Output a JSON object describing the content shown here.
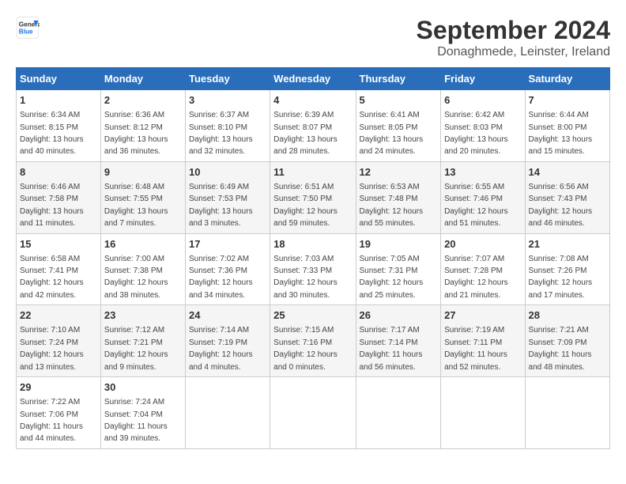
{
  "header": {
    "logo_general": "General",
    "logo_blue": "Blue",
    "main_title": "September 2024",
    "subtitle": "Donaghmede, Leinster, Ireland"
  },
  "days_of_week": [
    "Sunday",
    "Monday",
    "Tuesday",
    "Wednesday",
    "Thursday",
    "Friday",
    "Saturday"
  ],
  "weeks": [
    [
      {
        "day": "1",
        "sunrise": "6:34 AM",
        "sunset": "8:15 PM",
        "daylight": "13 hours and 40 minutes."
      },
      {
        "day": "2",
        "sunrise": "6:36 AM",
        "sunset": "8:12 PM",
        "daylight": "13 hours and 36 minutes."
      },
      {
        "day": "3",
        "sunrise": "6:37 AM",
        "sunset": "8:10 PM",
        "daylight": "13 hours and 32 minutes."
      },
      {
        "day": "4",
        "sunrise": "6:39 AM",
        "sunset": "8:07 PM",
        "daylight": "13 hours and 28 minutes."
      },
      {
        "day": "5",
        "sunrise": "6:41 AM",
        "sunset": "8:05 PM",
        "daylight": "13 hours and 24 minutes."
      },
      {
        "day": "6",
        "sunrise": "6:42 AM",
        "sunset": "8:03 PM",
        "daylight": "13 hours and 20 minutes."
      },
      {
        "day": "7",
        "sunrise": "6:44 AM",
        "sunset": "8:00 PM",
        "daylight": "13 hours and 15 minutes."
      }
    ],
    [
      {
        "day": "8",
        "sunrise": "6:46 AM",
        "sunset": "7:58 PM",
        "daylight": "13 hours and 11 minutes."
      },
      {
        "day": "9",
        "sunrise": "6:48 AM",
        "sunset": "7:55 PM",
        "daylight": "13 hours and 7 minutes."
      },
      {
        "day": "10",
        "sunrise": "6:49 AM",
        "sunset": "7:53 PM",
        "daylight": "13 hours and 3 minutes."
      },
      {
        "day": "11",
        "sunrise": "6:51 AM",
        "sunset": "7:50 PM",
        "daylight": "12 hours and 59 minutes."
      },
      {
        "day": "12",
        "sunrise": "6:53 AM",
        "sunset": "7:48 PM",
        "daylight": "12 hours and 55 minutes."
      },
      {
        "day": "13",
        "sunrise": "6:55 AM",
        "sunset": "7:46 PM",
        "daylight": "12 hours and 51 minutes."
      },
      {
        "day": "14",
        "sunrise": "6:56 AM",
        "sunset": "7:43 PM",
        "daylight": "12 hours and 46 minutes."
      }
    ],
    [
      {
        "day": "15",
        "sunrise": "6:58 AM",
        "sunset": "7:41 PM",
        "daylight": "12 hours and 42 minutes."
      },
      {
        "day": "16",
        "sunrise": "7:00 AM",
        "sunset": "7:38 PM",
        "daylight": "12 hours and 38 minutes."
      },
      {
        "day": "17",
        "sunrise": "7:02 AM",
        "sunset": "7:36 PM",
        "daylight": "12 hours and 34 minutes."
      },
      {
        "day": "18",
        "sunrise": "7:03 AM",
        "sunset": "7:33 PM",
        "daylight": "12 hours and 30 minutes."
      },
      {
        "day": "19",
        "sunrise": "7:05 AM",
        "sunset": "7:31 PM",
        "daylight": "12 hours and 25 minutes."
      },
      {
        "day": "20",
        "sunrise": "7:07 AM",
        "sunset": "7:28 PM",
        "daylight": "12 hours and 21 minutes."
      },
      {
        "day": "21",
        "sunrise": "7:08 AM",
        "sunset": "7:26 PM",
        "daylight": "12 hours and 17 minutes."
      }
    ],
    [
      {
        "day": "22",
        "sunrise": "7:10 AM",
        "sunset": "7:24 PM",
        "daylight": "12 hours and 13 minutes."
      },
      {
        "day": "23",
        "sunrise": "7:12 AM",
        "sunset": "7:21 PM",
        "daylight": "12 hours and 9 minutes."
      },
      {
        "day": "24",
        "sunrise": "7:14 AM",
        "sunset": "7:19 PM",
        "daylight": "12 hours and 4 minutes."
      },
      {
        "day": "25",
        "sunrise": "7:15 AM",
        "sunset": "7:16 PM",
        "daylight": "12 hours and 0 minutes."
      },
      {
        "day": "26",
        "sunrise": "7:17 AM",
        "sunset": "7:14 PM",
        "daylight": "11 hours and 56 minutes."
      },
      {
        "day": "27",
        "sunrise": "7:19 AM",
        "sunset": "7:11 PM",
        "daylight": "11 hours and 52 minutes."
      },
      {
        "day": "28",
        "sunrise": "7:21 AM",
        "sunset": "7:09 PM",
        "daylight": "11 hours and 48 minutes."
      }
    ],
    [
      {
        "day": "29",
        "sunrise": "7:22 AM",
        "sunset": "7:06 PM",
        "daylight": "11 hours and 44 minutes."
      },
      {
        "day": "30",
        "sunrise": "7:24 AM",
        "sunset": "7:04 PM",
        "daylight": "11 hours and 39 minutes."
      },
      null,
      null,
      null,
      null,
      null
    ]
  ]
}
